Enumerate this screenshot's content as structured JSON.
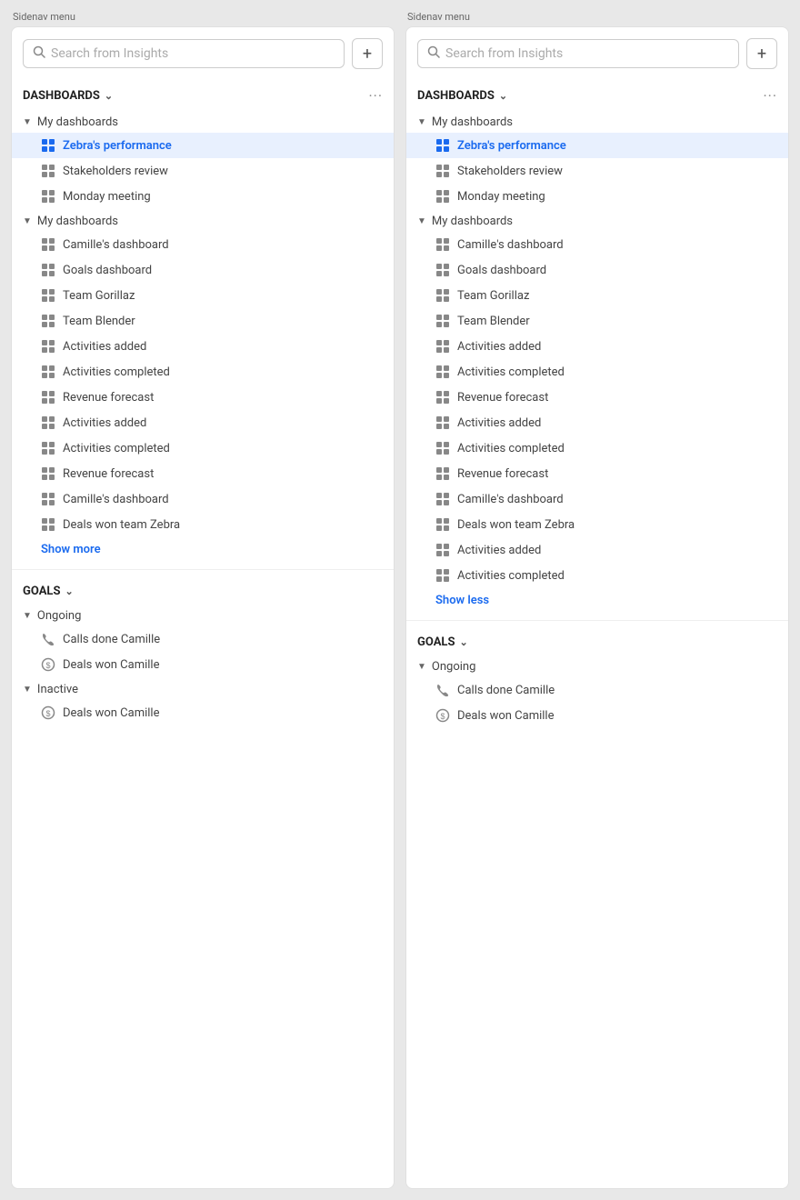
{
  "panels": [
    {
      "label": "Sidenav menu",
      "search": {
        "placeholder": "Search from Insights"
      },
      "add_button_label": "+",
      "sections": [
        {
          "id": "dashboards",
          "title": "DASHBOARDS",
          "groups": [
            {
              "label": "My dashboards",
              "collapsed": false,
              "items": [
                {
                  "name": "Zebra's performance",
                  "active": true
                },
                {
                  "name": "Stakeholders review"
                },
                {
                  "name": "Monday meeting"
                }
              ]
            },
            {
              "label": "My dashboards",
              "collapsed": false,
              "items": [
                {
                  "name": "Camille's dashboard"
                },
                {
                  "name": "Goals dashboard"
                },
                {
                  "name": "Team Gorillaz"
                },
                {
                  "name": "Team Blender"
                },
                {
                  "name": "Activities added"
                },
                {
                  "name": "Activities completed"
                },
                {
                  "name": "Revenue forecast"
                },
                {
                  "name": "Activities added"
                },
                {
                  "name": "Activities completed"
                },
                {
                  "name": "Revenue forecast"
                },
                {
                  "name": "Camille's dashboard"
                },
                {
                  "name": "Deals won team Zebra"
                }
              ]
            }
          ],
          "show_link": "Show more",
          "show_link_type": "more"
        }
      ],
      "goals_section": {
        "title": "GOALS",
        "groups": [
          {
            "label": "Ongoing",
            "items": [
              {
                "name": "Calls done Camille",
                "icon": "phone"
              },
              {
                "name": "Deals won Camille",
                "icon": "dollar"
              }
            ]
          },
          {
            "label": "Inactive",
            "items": [
              {
                "name": "Deals won Camille",
                "icon": "dollar"
              }
            ]
          }
        ]
      }
    },
    {
      "label": "Sidenav menu",
      "search": {
        "placeholder": "Search from Insights"
      },
      "add_button_label": "+",
      "sections": [
        {
          "id": "dashboards",
          "title": "DASHBOARDS",
          "groups": [
            {
              "label": "My dashboards",
              "collapsed": false,
              "items": [
                {
                  "name": "Zebra's performance",
                  "active": true
                },
                {
                  "name": "Stakeholders review"
                },
                {
                  "name": "Monday meeting"
                }
              ]
            },
            {
              "label": "My dashboards",
              "collapsed": false,
              "items": [
                {
                  "name": "Camille's dashboard"
                },
                {
                  "name": "Goals dashboard"
                },
                {
                  "name": "Team Gorillaz"
                },
                {
                  "name": "Team Blender"
                },
                {
                  "name": "Activities added"
                },
                {
                  "name": "Activities completed"
                },
                {
                  "name": "Revenue forecast"
                },
                {
                  "name": "Activities added"
                },
                {
                  "name": "Activities completed"
                },
                {
                  "name": "Revenue forecast"
                },
                {
                  "name": "Camille's dashboard"
                },
                {
                  "name": "Deals won team Zebra"
                },
                {
                  "name": "Activities added"
                },
                {
                  "name": "Activities completed"
                }
              ]
            }
          ],
          "show_link": "Show less",
          "show_link_type": "less"
        }
      ],
      "goals_section": {
        "title": "GOALS",
        "groups": [
          {
            "label": "Ongoing",
            "items": [
              {
                "name": "Calls done Camille",
                "icon": "phone"
              },
              {
                "name": "Deals won Camille",
                "icon": "dollar"
              }
            ]
          }
        ]
      }
    }
  ]
}
